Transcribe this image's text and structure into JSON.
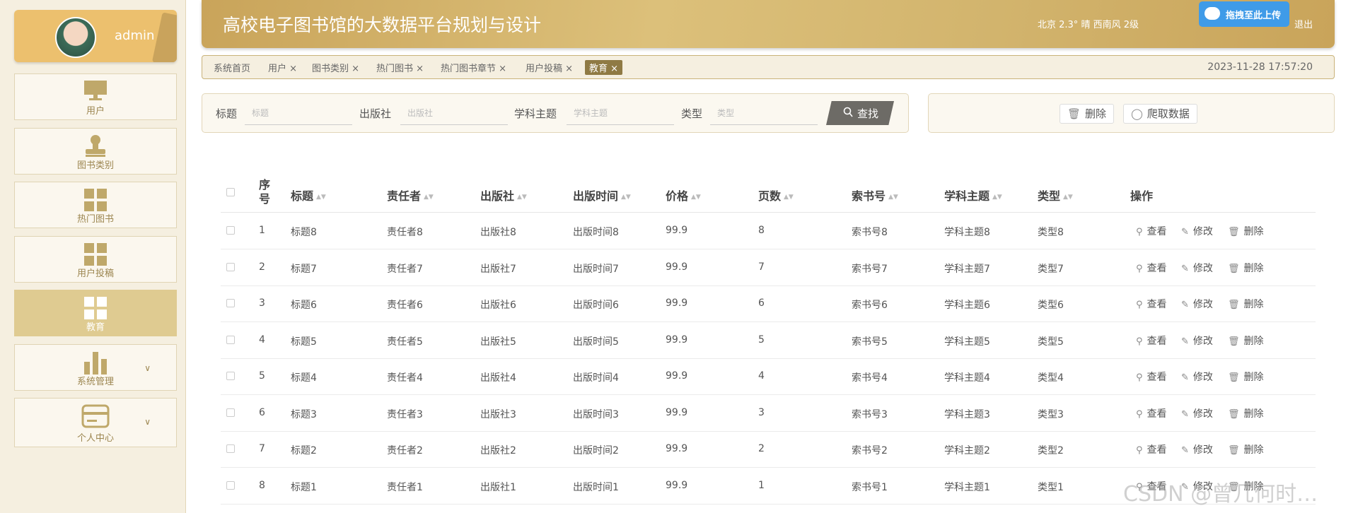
{
  "sidebar": {
    "user": {
      "name": "admin"
    },
    "items": [
      {
        "label": "用户",
        "icon": "monitor-icon"
      },
      {
        "label": "图书类别",
        "icon": "stamp-icon"
      },
      {
        "label": "热门图书",
        "icon": "grid-icon"
      },
      {
        "label": "用户投稿",
        "icon": "grid-icon"
      },
      {
        "label": "教育",
        "icon": "grid-icon",
        "active": true
      },
      {
        "label": "系统管理",
        "icon": "bar-chart-icon",
        "expandable": true
      },
      {
        "label": "个人中心",
        "icon": "card-icon",
        "expandable": true
      }
    ]
  },
  "header": {
    "title": "高校电子图书馆的大数据平台规划与设计",
    "weather": "北京  2.3°  晴  西南风  2级",
    "upload_label": "拖拽至此上传",
    "logout_label": "退出"
  },
  "tabs": {
    "items": [
      "系统首页",
      "用户 ×",
      "图书类别 ×",
      "热门图书 ×",
      "热门图书章节 ×",
      "用户投稿 ×",
      "教育 ×"
    ],
    "datetime": "2023-11-28 17:57:20"
  },
  "search": {
    "fields": [
      {
        "label": "标题",
        "placeholder": "标题"
      },
      {
        "label": "出版社",
        "placeholder": "出版社"
      },
      {
        "label": "学科主题",
        "placeholder": "学科主题"
      },
      {
        "label": "类型",
        "placeholder": "类型"
      }
    ],
    "find_label": "查找"
  },
  "actions": {
    "delete_label": "删除",
    "crawl_label": "爬取数据"
  },
  "table": {
    "headers": [
      "序号",
      "标题",
      "责任者",
      "出版社",
      "出版时间",
      "价格",
      "页数",
      "索书号",
      "学科主题",
      "类型",
      "操作"
    ],
    "rows": [
      [
        "1",
        "标题8",
        "责任者8",
        "出版社8",
        "出版时间8",
        "99.9",
        "8",
        "索书号8",
        "学科主题8",
        "类型8"
      ],
      [
        "2",
        "标题7",
        "责任者7",
        "出版社7",
        "出版时间7",
        "99.9",
        "7",
        "索书号7",
        "学科主题7",
        "类型7"
      ],
      [
        "3",
        "标题6",
        "责任者6",
        "出版社6",
        "出版时间6",
        "99.9",
        "6",
        "索书号6",
        "学科主题6",
        "类型6"
      ],
      [
        "4",
        "标题5",
        "责任者5",
        "出版社5",
        "出版时间5",
        "99.9",
        "5",
        "索书号5",
        "学科主题5",
        "类型5"
      ],
      [
        "5",
        "标题4",
        "责任者4",
        "出版社4",
        "出版时间4",
        "99.9",
        "4",
        "索书号4",
        "学科主题4",
        "类型4"
      ],
      [
        "6",
        "标题3",
        "责任者3",
        "出版社3",
        "出版时间3",
        "99.9",
        "3",
        "索书号3",
        "学科主题3",
        "类型3"
      ],
      [
        "7",
        "标题2",
        "责任者2",
        "出版社2",
        "出版时间2",
        "99.9",
        "2",
        "索书号2",
        "学科主题2",
        "类型2"
      ],
      [
        "8",
        "标题1",
        "责任者1",
        "出版社1",
        "出版时间1",
        "99.9",
        "1",
        "索书号1",
        "学科主题1",
        "类型1"
      ]
    ],
    "ops": [
      "查看",
      "修改",
      "删除"
    ]
  },
  "watermark": "CSDN @曾几何时…",
  "colors": {
    "accent": "#c9a45a",
    "active_menu": "#dfcb91",
    "find_button": "#6d6b66",
    "upload_button": "#3f9be8"
  }
}
